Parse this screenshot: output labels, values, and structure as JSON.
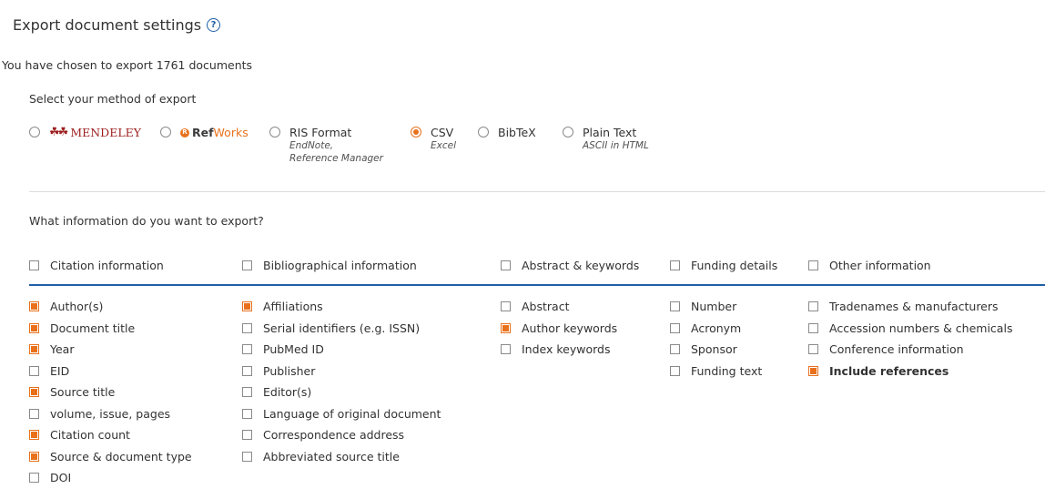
{
  "header": {
    "title": "Export document settings",
    "help_icon": "help-circle-icon",
    "subtitle": "You have chosen to export 1761 documents"
  },
  "export_method": {
    "label": "Select your method of export",
    "options": [
      {
        "label": "MENDELEY",
        "sub": [],
        "checked": false,
        "logo": "mendeley-logo"
      },
      {
        "label_ref": "Ref",
        "label_works": "Works",
        "sub": [],
        "checked": false,
        "logo": "refworks-logo"
      },
      {
        "label": "RIS Format",
        "sub": [
          "EndNote,",
          "Reference Manager"
        ],
        "checked": false
      },
      {
        "label": "CSV",
        "sub": [
          "Excel"
        ],
        "checked": true
      },
      {
        "label": "BibTeX",
        "sub": [],
        "checked": false
      },
      {
        "label": "Plain Text",
        "sub": [
          "ASCII in HTML"
        ],
        "checked": false
      }
    ]
  },
  "info": {
    "label": "What information do you want to export?",
    "columns": [
      {
        "header": "Citation information",
        "header_checked": false,
        "items": [
          {
            "label": "Author(s)",
            "checked": true
          },
          {
            "label": "Document title",
            "checked": true
          },
          {
            "label": "Year",
            "checked": true
          },
          {
            "label": "EID",
            "checked": false
          },
          {
            "label": "Source title",
            "checked": true
          },
          {
            "label": "volume, issue, pages",
            "checked": false
          },
          {
            "label": "Citation count",
            "checked": true
          },
          {
            "label": "Source & document type",
            "checked": true
          },
          {
            "label": "DOI",
            "checked": false
          }
        ]
      },
      {
        "header": "Bibliographical information",
        "header_checked": false,
        "items": [
          {
            "label": "Affiliations",
            "checked": true
          },
          {
            "label": "Serial identifiers (e.g. ISSN)",
            "checked": false
          },
          {
            "label": "PubMed ID",
            "checked": false
          },
          {
            "label": "Publisher",
            "checked": false
          },
          {
            "label": "Editor(s)",
            "checked": false
          },
          {
            "label": "Language of original document",
            "checked": false
          },
          {
            "label": "Correspondence address",
            "checked": false
          },
          {
            "label": "Abbreviated source title",
            "checked": false
          }
        ]
      },
      {
        "header": "Abstract & keywords",
        "header_checked": false,
        "items": [
          {
            "label": "Abstract",
            "checked": false
          },
          {
            "label": "Author keywords",
            "checked": true
          },
          {
            "label": "Index keywords",
            "checked": false
          }
        ]
      },
      {
        "header": "Funding details",
        "header_checked": false,
        "items": [
          {
            "label": "Number",
            "checked": false
          },
          {
            "label": "Acronym",
            "checked": false
          },
          {
            "label": "Sponsor",
            "checked": false
          },
          {
            "label": "Funding text",
            "checked": false
          }
        ]
      },
      {
        "header": "Other information",
        "header_checked": false,
        "items": [
          {
            "label": "Tradenames & manufacturers",
            "checked": false
          },
          {
            "label": "Accession numbers & chemicals",
            "checked": false
          },
          {
            "label": "Conference information",
            "checked": false
          },
          {
            "label": "Include references",
            "checked": true,
            "bold": true
          }
        ]
      }
    ]
  },
  "colors": {
    "accent": "#e9711c",
    "link_blue": "#1f5fa6",
    "mendeley_red": "#9d1e1e"
  }
}
